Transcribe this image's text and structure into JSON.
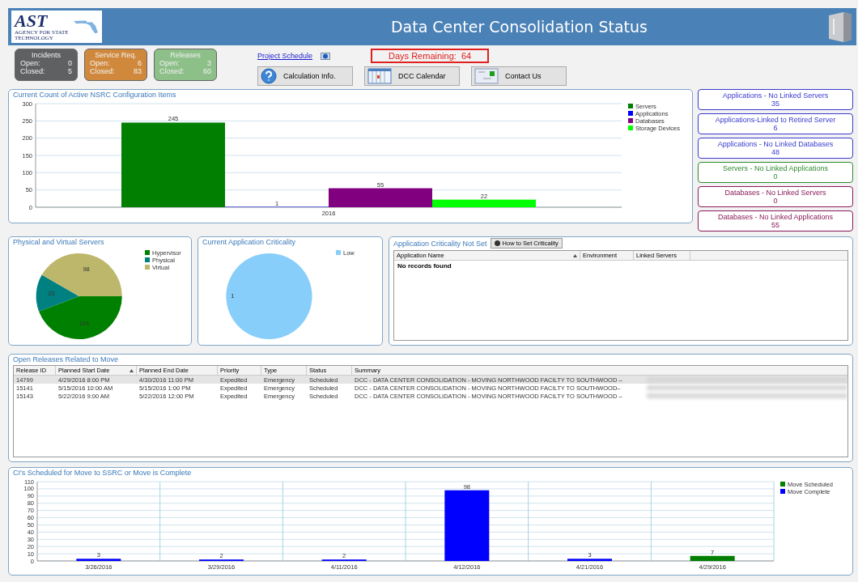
{
  "header": {
    "logo": {
      "text": "AST",
      "subtitle": "AGENCY FOR STATE TECHNOLOGY"
    },
    "title": "Data Center Consolidation Status"
  },
  "stat_cards": [
    {
      "title": "Incidents",
      "color": "#5e6062",
      "rows": [
        {
          "label": "Open:",
          "value": "0"
        },
        {
          "label": "Closed:",
          "value": "5"
        }
      ]
    },
    {
      "title": "Service Req.",
      "color": "#d0893c",
      "rows": [
        {
          "label": "Open:",
          "value": "6"
        },
        {
          "label": "Closed:",
          "value": "83"
        }
      ]
    },
    {
      "title": "Releases",
      "color": "#8dbf88",
      "rows": [
        {
          "label": "Open:",
          "value": "3"
        },
        {
          "label": "Closed:",
          "value": "60"
        }
      ]
    }
  ],
  "project_schedule_link": "Project Schedule",
  "days_remaining": "Days Remaining:  64",
  "buttons": [
    {
      "kind": "help",
      "label": "Calculation Info."
    },
    {
      "kind": "calendar",
      "label": "DCC Calendar"
    },
    {
      "kind": "mail",
      "label": "Contact Us"
    }
  ],
  "config_chart": {
    "title": "Current Count of Active NSRC Configuration Items",
    "chart_data": {
      "type": "bar",
      "categories": [
        "2016"
      ],
      "ylim": [
        0,
        300
      ],
      "yticks": [
        0,
        50,
        100,
        150,
        200,
        250,
        300
      ],
      "data_labels": true,
      "grid": true,
      "legend": true,
      "series": [
        {
          "name": "Servers",
          "color": "#007f00",
          "values": [
            245
          ]
        },
        {
          "name": "Applications",
          "color": "#0000ff",
          "values": [
            1
          ]
        },
        {
          "name": "Databases",
          "color": "#800080",
          "values": [
            55
          ]
        },
        {
          "name": "Storage Devices",
          "color": "#00ff00",
          "values": [
            22
          ]
        }
      ]
    }
  },
  "summary_boxes": [
    {
      "label": "Applications - No Linked Servers",
      "value": "35",
      "color": "#3a3ad0"
    },
    {
      "label": "Applications-Linked to Retired Server",
      "value": "6",
      "color": "#3a3ad0"
    },
    {
      "label": "Applications - No Linked Databases",
      "value": "48",
      "color": "#3a3ad0"
    },
    {
      "label": "Servers - No Linked Applications",
      "value": "0",
      "color": "#2e8b2e"
    },
    {
      "label": "Databases - No Linked Servers",
      "value": "0",
      "color": "#8b1a5a"
    },
    {
      "label": "Databases - No Linked Applications",
      "value": "55",
      "color": "#8b1a5a"
    }
  ],
  "servers_chart": {
    "title": "Physical and Virtual Servers",
    "chart_data": {
      "type": "pie",
      "categories": [
        "Hypervisor",
        "Physical",
        "Virtual"
      ],
      "values": [
        104,
        33,
        98
      ],
      "colors": [
        "#008000",
        "#008080",
        "#bdb76b"
      ],
      "data_labels": true,
      "legend": true
    }
  },
  "criticality_chart": {
    "title": "Current Application Criticality",
    "chart_data": {
      "type": "pie",
      "categories": [
        "Low"
      ],
      "values": [
        1
      ],
      "colors": [
        "#87cefa"
      ],
      "data_labels": true,
      "legend": true
    }
  },
  "criticality_not_set": {
    "title": "Application Criticality Not Set",
    "help_button": "How to Set Criticality",
    "columns": [
      {
        "label": "Application Name",
        "sorted": true
      },
      {
        "label": "Environment",
        "sorted": false
      },
      {
        "label": "Linked Servers",
        "sorted": false
      }
    ],
    "empty_message": "No records found"
  },
  "releases": {
    "title": "Open Releases Related to Move",
    "columns": [
      {
        "label": "Release ID",
        "sorted": false
      },
      {
        "label": "Planned Start Date",
        "sorted": true
      },
      {
        "label": "Planned End Date",
        "sorted": false
      },
      {
        "label": "Priority",
        "sorted": false
      },
      {
        "label": "Type",
        "sorted": false
      },
      {
        "label": "Status",
        "sorted": false
      },
      {
        "label": "Summary",
        "sorted": false
      }
    ],
    "rows": [
      {
        "cells": [
          "14799",
          "4/29/2016 8:00 PM",
          "4/30/2016 11:00 PM",
          "Expedited",
          "Emergency",
          "Scheduled",
          "DCC - DATA CENTER CONSOLIDATION - MOVING NORTHWOOD FACILTY TO SOUTHWOOD –"
        ],
        "selected": true
      },
      {
        "cells": [
          "15141",
          "5/15/2016 10:00 AM",
          "5/15/2016 1:00 PM",
          "Expedited",
          "Emergency",
          "Scheduled",
          "DCC - DATA CENTER CONSOLIDATION - MOVING NORTHWOOD FACILTY TO SOUTHWOOD–"
        ],
        "selected": false
      },
      {
        "cells": [
          "15143",
          "5/22/2016 9:00 AM",
          "5/22/2016 12:00 PM",
          "Expedited",
          "Emergency",
          "Scheduled",
          "DCC - DATA CENTER CONSOLIDATION - MOVING NORTHWOOD FACILTY TO SOUTHWOOD –"
        ],
        "selected": false
      }
    ]
  },
  "move_chart": {
    "title": "CI's Scheduled for Move to SSRC or Move is Complete",
    "chart_data": {
      "type": "bar",
      "categories": [
        "3/26/2016",
        "3/29/2016",
        "4/11/2016",
        "4/12/2016",
        "4/21/2016",
        "4/29/2016"
      ],
      "ylim": [
        0,
        110
      ],
      "yticks": [
        0,
        10,
        20,
        30,
        40,
        50,
        60,
        70,
        80,
        90,
        100,
        110
      ],
      "data_labels": true,
      "grid": true,
      "legend": true,
      "series": [
        {
          "name": "Move Scheduled",
          "color": "#007f00",
          "values": [
            null,
            null,
            null,
            null,
            null,
            7
          ]
        },
        {
          "name": "Move Complete",
          "color": "#0000ff",
          "values": [
            3,
            2,
            2,
            98,
            3,
            null
          ]
        }
      ]
    }
  }
}
